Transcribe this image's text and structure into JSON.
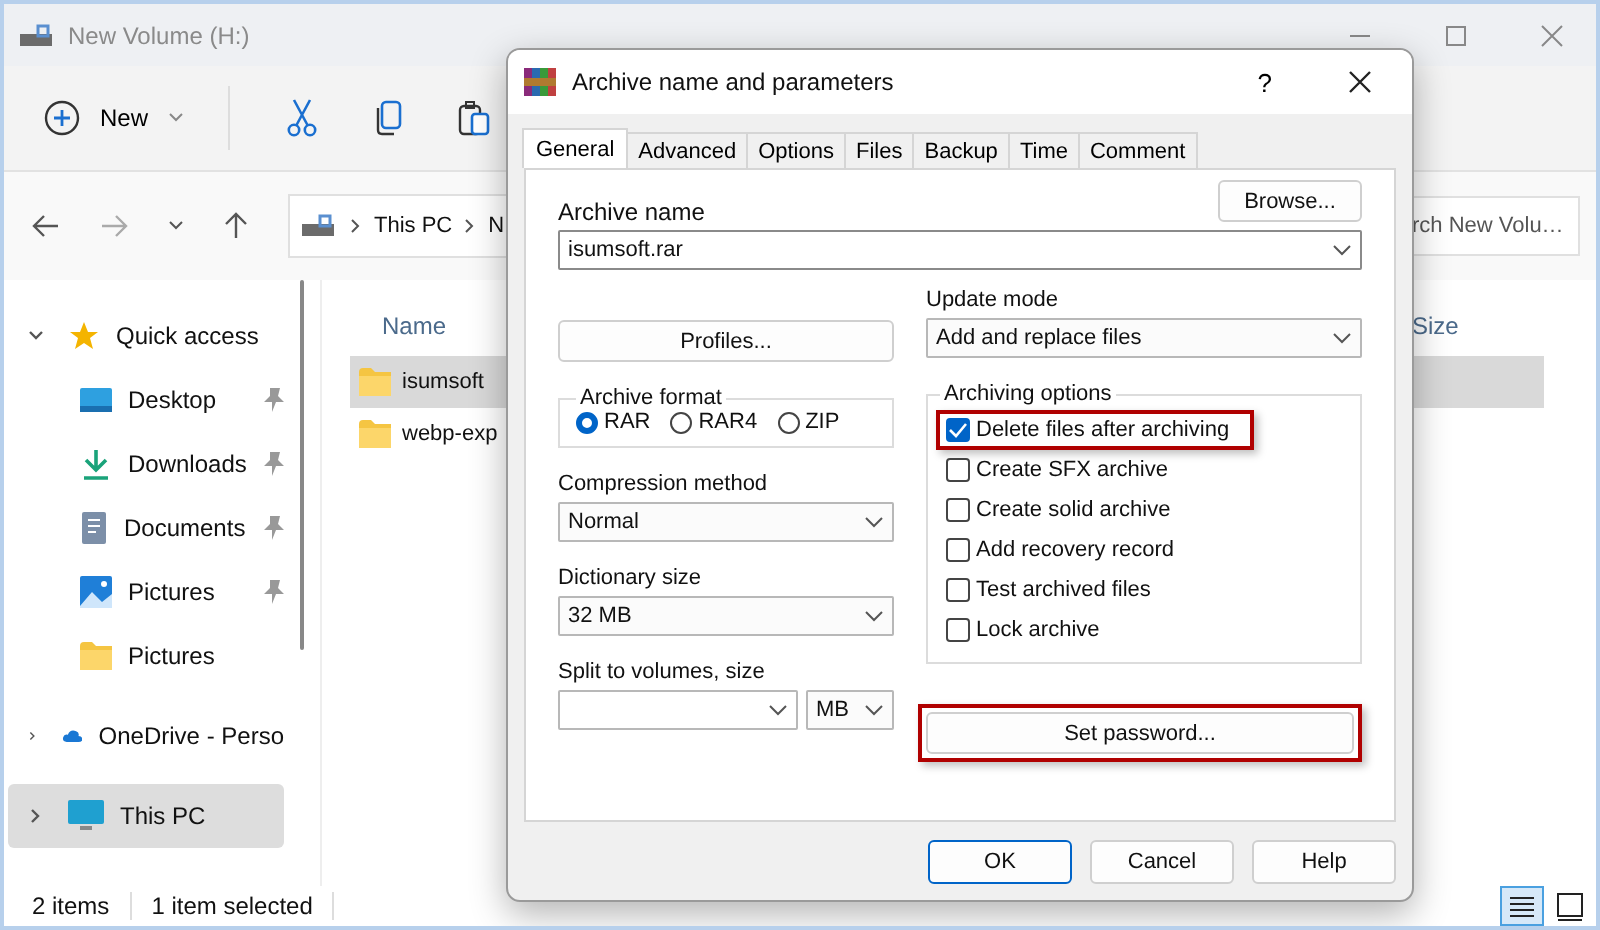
{
  "explorer": {
    "title": "New Volume (H:)",
    "new_button": "New",
    "breadcrumb": [
      "This PC",
      "N"
    ],
    "search": {
      "placeholder": "rch New Volu…"
    },
    "columns": [
      "Name",
      "Size"
    ],
    "files": [
      {
        "name": "isumsoft",
        "selected": true
      },
      {
        "name": "webp-exp",
        "selected": false
      }
    ],
    "sidebar": [
      {
        "label": "Quick access",
        "kind": "star",
        "pinned": false,
        "expanded": true,
        "selected": false
      },
      {
        "label": "Desktop",
        "kind": "desktop",
        "pinned": true,
        "selected": false
      },
      {
        "label": "Downloads",
        "kind": "download",
        "pinned": true,
        "selected": false
      },
      {
        "label": "Documents",
        "kind": "document",
        "pinned": true,
        "selected": false
      },
      {
        "label": "Pictures",
        "kind": "pictures",
        "pinned": true,
        "selected": false
      },
      {
        "label": "Pictures",
        "kind": "folder",
        "pinned": false,
        "selected": false
      },
      {
        "label": "OneDrive - Perso",
        "kind": "cloud",
        "pinned": false,
        "expanded": false,
        "selected": false
      },
      {
        "label": "This PC",
        "kind": "pc",
        "pinned": false,
        "expanded": false,
        "selected": true
      }
    ],
    "status": [
      "2 items",
      "1 item selected"
    ]
  },
  "dialog": {
    "title": "Archive name and parameters",
    "help": "?",
    "tabs": [
      {
        "label": "General",
        "selected": true
      },
      {
        "label": "Advanced",
        "selected": false
      },
      {
        "label": "Options",
        "selected": false
      },
      {
        "label": "Files",
        "selected": false
      },
      {
        "label": "Backup",
        "selected": false
      },
      {
        "label": "Time",
        "selected": false
      },
      {
        "label": "Comment",
        "selected": false
      }
    ],
    "archive_name": {
      "label": "Archive name",
      "value": "isumsoft.rar",
      "browse": "Browse..."
    },
    "profiles": "Profiles...",
    "update_mode": {
      "label": "Update mode",
      "value": "Add and replace files"
    },
    "archive_format": {
      "label": "Archive format",
      "options": [
        {
          "label": "RAR",
          "selected": true
        },
        {
          "label": "RAR4",
          "selected": false
        },
        {
          "label": "ZIP",
          "selected": false
        }
      ]
    },
    "compression_method": {
      "label": "Compression method",
      "value": "Normal"
    },
    "dictionary_size": {
      "label": "Dictionary size",
      "value": "32 MB"
    },
    "split": {
      "label": "Split to volumes, size",
      "unit": "MB"
    },
    "archiving_options": {
      "label": "Archiving options",
      "options": [
        {
          "label": "Delete files after archiving",
          "checked": true,
          "highlighted": true
        },
        {
          "label": "Create SFX archive",
          "checked": false,
          "highlighted": false
        },
        {
          "label": "Create solid archive",
          "checked": false,
          "highlighted": false
        },
        {
          "label": "Add recovery record",
          "checked": false,
          "highlighted": false
        },
        {
          "label": "Test archived files",
          "checked": false,
          "highlighted": false
        },
        {
          "label": "Lock archive",
          "checked": false,
          "highlighted": false
        }
      ]
    },
    "set_password": {
      "label": "Set password...",
      "highlighted": true
    },
    "buttons": [
      "OK",
      "Cancel",
      "Help"
    ]
  }
}
